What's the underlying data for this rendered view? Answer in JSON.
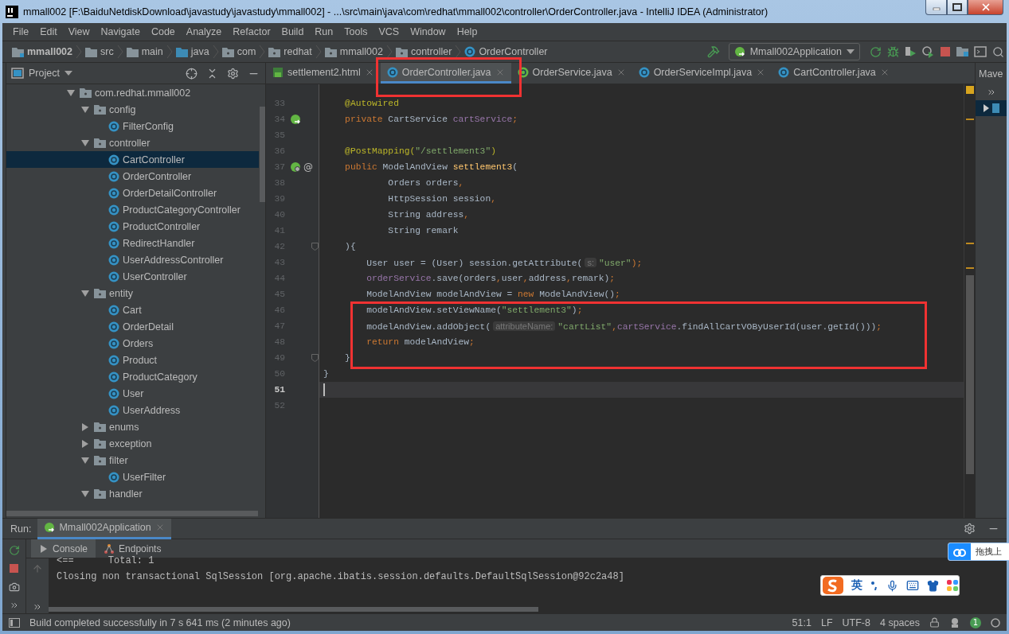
{
  "window": {
    "title": "mmall002 [F:\\BaiduNetdiskDownload\\javastudy\\javastudy\\mmall002] - ...\\src\\main\\java\\com\\redhat\\mmall002\\controller\\OrderController.java - IntelliJ IDEA (Administrator)"
  },
  "menu": [
    "File",
    "Edit",
    "View",
    "Navigate",
    "Code",
    "Analyze",
    "Refactor",
    "Build",
    "Run",
    "Tools",
    "VCS",
    "Window",
    "Help"
  ],
  "breadcrumbs": [
    {
      "label": "mmall002",
      "kind": "module"
    },
    {
      "label": "src",
      "kind": "folder"
    },
    {
      "label": "main",
      "kind": "folder"
    },
    {
      "label": "java",
      "kind": "source"
    },
    {
      "label": "com",
      "kind": "package"
    },
    {
      "label": "redhat",
      "kind": "package"
    },
    {
      "label": "mmall002",
      "kind": "package"
    },
    {
      "label": "controller",
      "kind": "package"
    },
    {
      "label": "OrderController",
      "kind": "class"
    }
  ],
  "run_config": "Mmall002Application",
  "project_panel": {
    "title": "Project",
    "tree": [
      {
        "label": "com.redhat.mmall002",
        "kind": "package",
        "expanded": true,
        "selected": false,
        "children": [
          {
            "label": "config",
            "kind": "package",
            "expanded": true,
            "selected": false,
            "children": [
              {
                "label": "FilterConfig",
                "kind": "class",
                "selected": false
              }
            ]
          },
          {
            "label": "controller",
            "kind": "package",
            "expanded": true,
            "selected": false,
            "children": [
              {
                "label": "CartController",
                "kind": "class",
                "selected": true
              },
              {
                "label": "OrderController",
                "kind": "class",
                "selected": false
              },
              {
                "label": "OrderDetailController",
                "kind": "class",
                "selected": false
              },
              {
                "label": "ProductCategoryController",
                "kind": "class",
                "selected": false
              },
              {
                "label": "ProductController",
                "kind": "class",
                "selected": false
              },
              {
                "label": "RedirectHandler",
                "kind": "class",
                "selected": false
              },
              {
                "label": "UserAddressController",
                "kind": "class",
                "selected": false
              },
              {
                "label": "UserController",
                "kind": "class",
                "selected": false
              }
            ]
          },
          {
            "label": "entity",
            "kind": "package",
            "expanded": true,
            "selected": false,
            "children": [
              {
                "label": "Cart",
                "kind": "class",
                "selected": false
              },
              {
                "label": "OrderDetail",
                "kind": "class",
                "selected": false
              },
              {
                "label": "Orders",
                "kind": "class",
                "selected": false
              },
              {
                "label": "Product",
                "kind": "class",
                "selected": false
              },
              {
                "label": "ProductCategory",
                "kind": "class",
                "selected": false
              },
              {
                "label": "User",
                "kind": "class",
                "selected": false
              },
              {
                "label": "UserAddress",
                "kind": "class",
                "selected": false
              }
            ]
          },
          {
            "label": "enums",
            "kind": "package",
            "expanded": false,
            "selected": false
          },
          {
            "label": "exception",
            "kind": "package",
            "expanded": false,
            "selected": false
          },
          {
            "label": "filter",
            "kind": "package",
            "expanded": true,
            "selected": false,
            "children": [
              {
                "label": "UserFilter",
                "kind": "class",
                "selected": false
              }
            ]
          },
          {
            "label": "handler",
            "kind": "package",
            "expanded": true,
            "selected": false
          }
        ]
      }
    ]
  },
  "editor_tabs": [
    {
      "label": "settlement2.html",
      "kind": "html",
      "selected": false
    },
    {
      "label": "OrderController.java",
      "kind": "class",
      "selected": true
    },
    {
      "label": "OrderService.java",
      "kind": "interface",
      "selected": false
    },
    {
      "label": "OrderServiceImpl.java",
      "kind": "class",
      "selected": false
    },
    {
      "label": "CartController.java",
      "kind": "class",
      "selected": false
    }
  ],
  "side_tab": "Mave",
  "editor": {
    "lines": [
      {
        "number": "33",
        "current": false,
        "tokens": [
          {
            "text": "    @Autowired",
            "kind": "annotation"
          }
        ]
      },
      {
        "number": "34",
        "current": false,
        "gutter": {
          "kind": "bean"
        },
        "tokens": [
          {
            "text": "    private",
            "kind": "keyword"
          },
          {
            "text": " CartService ",
            "kind": "plain"
          },
          {
            "text": "cartService",
            "kind": "field"
          },
          {
            "text": ";",
            "kind": "keyword"
          }
        ]
      },
      {
        "number": "35",
        "current": false
      },
      {
        "number": "36",
        "current": false,
        "tokens": [
          {
            "text": "    @PostMapping(",
            "kind": "annotation"
          },
          {
            "text": "\"/settlement3\"",
            "kind": "string"
          },
          {
            "text": ")",
            "kind": "annotation"
          }
        ]
      },
      {
        "number": "37",
        "current": false,
        "gutter": {
          "kind": "web",
          "mark": "@"
        },
        "tokens": [
          {
            "text": "    public",
            "kind": "keyword"
          },
          {
            "text": " ModelAndView ",
            "kind": "plain"
          },
          {
            "text": "settlement3",
            "kind": "method"
          },
          {
            "text": "(",
            "kind": "plain"
          }
        ]
      },
      {
        "number": "38",
        "current": false,
        "tokens": [
          {
            "text": "            Orders orders",
            "kind": "plain"
          },
          {
            "text": ",",
            "kind": "keyword"
          }
        ]
      },
      {
        "number": "39",
        "current": false,
        "tokens": [
          {
            "text": "            HttpSession session",
            "kind": "plain"
          },
          {
            "text": ",",
            "kind": "keyword"
          }
        ]
      },
      {
        "number": "40",
        "current": false,
        "tokens": [
          {
            "text": "            String address",
            "kind": "plain"
          },
          {
            "text": ",",
            "kind": "keyword"
          }
        ]
      },
      {
        "number": "41",
        "current": false,
        "tokens": [
          {
            "text": "            String remark",
            "kind": "plain"
          }
        ]
      },
      {
        "number": "42",
        "current": false,
        "fold": true,
        "tokens": [
          {
            "text": "    ){",
            "kind": "plain"
          }
        ]
      },
      {
        "number": "43",
        "current": false,
        "tokens": [
          {
            "text": "        User user = (User) session.getAttribute(",
            "kind": "plain"
          },
          {
            "text": "s:",
            "kind": "hint"
          },
          {
            "text": "\"user\"",
            "kind": "string"
          },
          {
            "text": ");",
            "kind": "keyword"
          }
        ]
      },
      {
        "number": "44",
        "current": false,
        "tokens": [
          {
            "text": "        orderService",
            "kind": "field"
          },
          {
            "text": ".save(orders",
            "kind": "plain"
          },
          {
            "text": ",",
            "kind": "keyword"
          },
          {
            "text": "user",
            "kind": "plain"
          },
          {
            "text": ",",
            "kind": "keyword"
          },
          {
            "text": "address",
            "kind": "plain"
          },
          {
            "text": ",",
            "kind": "keyword"
          },
          {
            "text": "remark)",
            "kind": "plain"
          },
          {
            "text": ";",
            "kind": "keyword"
          }
        ]
      },
      {
        "number": "45",
        "current": false,
        "tokens": [
          {
            "text": "        ModelAndView modelAndView = ",
            "kind": "plain"
          },
          {
            "text": "new",
            "kind": "keyword"
          },
          {
            "text": " ModelAndView()",
            "kind": "plain"
          },
          {
            "text": ";",
            "kind": "keyword"
          }
        ]
      },
      {
        "number": "46",
        "current": false,
        "tokens": [
          {
            "text": "        modelAndView.setViewName(",
            "kind": "plain"
          },
          {
            "text": "\"settlement3\"",
            "kind": "string"
          },
          {
            "text": ")",
            "kind": "plain"
          },
          {
            "text": ";",
            "kind": "keyword"
          }
        ]
      },
      {
        "number": "47",
        "current": false,
        "tokens": [
          {
            "text": "        modelAndView.addObject(",
            "kind": "plain"
          },
          {
            "text": "attributeName:",
            "kind": "hint"
          },
          {
            "text": "\"cartList\"",
            "kind": "string"
          },
          {
            "text": ",",
            "kind": "keyword"
          },
          {
            "text": "cartService",
            "kind": "field"
          },
          {
            "text": ".findAllCartVOByUserId(user.getId()))",
            "kind": "plain"
          },
          {
            "text": ";",
            "kind": "keyword"
          }
        ]
      },
      {
        "number": "48",
        "current": false,
        "tokens": [
          {
            "text": "        return",
            "kind": "keyword"
          },
          {
            "text": " modelAndView",
            "kind": "plain"
          },
          {
            "text": ";",
            "kind": "keyword"
          }
        ]
      },
      {
        "number": "49",
        "current": false,
        "fold": true,
        "tokens": [
          {
            "text": "    }",
            "kind": "plain"
          }
        ]
      },
      {
        "number": "50",
        "current": false,
        "tokens": [
          {
            "text": "}",
            "kind": "plain"
          }
        ]
      },
      {
        "number": "51",
        "current": true
      },
      {
        "number": "52",
        "current": false
      }
    ]
  },
  "run_panel": {
    "label": "Run:",
    "config": "Mmall002Application",
    "tabs": [
      {
        "label": "Console",
        "kind": "console",
        "selected": true
      },
      {
        "label": "Endpoints",
        "kind": "endpoints",
        "selected": false
      }
    ],
    "console": [
      "<==      Total: 1",
      "Closing non transactional SqlSession [org.apache.ibatis.session.defaults.DefaultSqlSession@92c2a48]"
    ]
  },
  "status_bar": {
    "message": "Build completed successfully in 7 s 641 ms (2 minutes ago)",
    "position": "51:1",
    "line_separator": "LF",
    "encoding": "UTF-8",
    "indent": "4 spaces",
    "notifications": "1"
  },
  "ime_toolbar": {
    "label": "英"
  },
  "floating_button": {
    "label": "拖拽上"
  }
}
